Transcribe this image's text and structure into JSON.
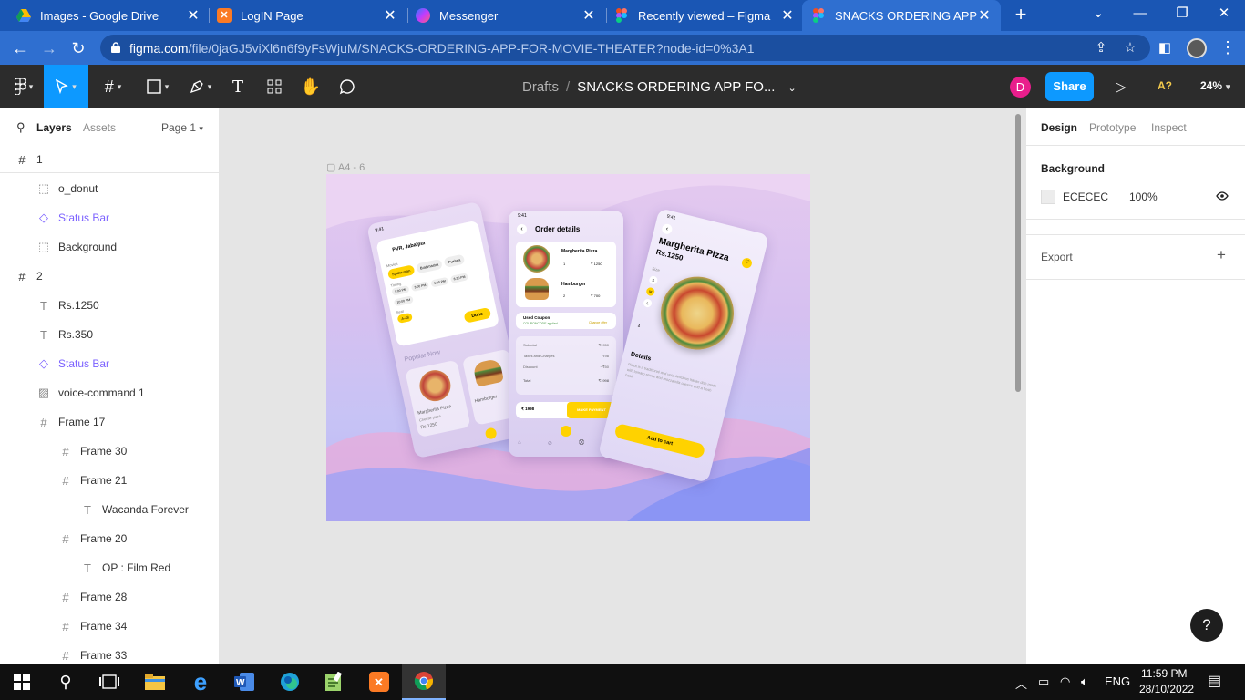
{
  "browser": {
    "tabs": [
      {
        "title": "Images - Google Drive",
        "icon": "google-drive-icon",
        "color": "#fbbc04"
      },
      {
        "title": "LogIN Page",
        "icon": "xampp-icon",
        "color": "#fb7a24"
      },
      {
        "title": "Messenger",
        "icon": "messenger-icon",
        "color": "#a033ff"
      },
      {
        "title": "Recently viewed – Figma",
        "icon": "figma-icon",
        "color": "#f24e1e"
      },
      {
        "title": "SNACKS ORDERING APP FOR",
        "icon": "figma-icon",
        "color": "#f24e1e"
      }
    ],
    "url_host": "figma.com",
    "url_path": "/file/0jaGJ5viXl6n6f9yFsWjuM/SNACKS-ORDERING-APP-FOR-MOVIE-THEATER?node-id=0%3A1"
  },
  "figma": {
    "breadcrumb_root": "Drafts",
    "file_name": "SNACKS ORDERING APP FO...",
    "avatar_initial": "D",
    "share_label": "Share",
    "a_question": "A?",
    "zoom": "24%",
    "left_tabs": {
      "layers": "Layers",
      "assets": "Assets",
      "page": "Page 1"
    },
    "layers": [
      {
        "label": "1",
        "icon": "#",
        "level": 0,
        "comp": false
      },
      {
        "label": "o_donut",
        "icon": "⬚",
        "level": 1,
        "comp": false
      },
      {
        "label": "Status Bar",
        "icon": "◇",
        "level": 1,
        "comp": true
      },
      {
        "label": "Background",
        "icon": "⬚",
        "level": 1,
        "comp": false
      },
      {
        "label": "2",
        "icon": "#",
        "level": 0,
        "comp": false
      },
      {
        "label": "Rs.1250",
        "icon": "T",
        "level": 1,
        "comp": false
      },
      {
        "label": "Rs.350",
        "icon": "T",
        "level": 1,
        "comp": false
      },
      {
        "label": "Status Bar",
        "icon": "◇",
        "level": 1,
        "comp": true
      },
      {
        "label": "voice-command 1",
        "icon": "▨",
        "level": 1,
        "comp": false
      },
      {
        "label": "Frame 17",
        "icon": "#",
        "level": 1,
        "comp": false
      },
      {
        "label": "Frame 30",
        "icon": "#",
        "level": 2,
        "comp": false
      },
      {
        "label": "Frame 21",
        "icon": "#",
        "level": 2,
        "comp": false
      },
      {
        "label": "Wacanda Forever",
        "icon": "T",
        "level": 3,
        "comp": false
      },
      {
        "label": "Frame 20",
        "icon": "#",
        "level": 2,
        "comp": false
      },
      {
        "label": "OP : Film Red",
        "icon": "T",
        "level": 3,
        "comp": false
      },
      {
        "label": "Frame 28",
        "icon": "#",
        "level": 2,
        "comp": false
      },
      {
        "label": "Frame 34",
        "icon": "#",
        "level": 2,
        "comp": false
      },
      {
        "label": "Frame 33",
        "icon": "#",
        "level": 2,
        "comp": false
      }
    ],
    "frame_label": "A4 - 6",
    "mockup": {
      "screen1": {
        "time": "9:41",
        "location": "PVR, Jabalpur",
        "sort_label": "Movies",
        "chips": [
          "Spider-man",
          "Brahmastra",
          "Pushpa",
          "Avatar"
        ],
        "times_label": "Timing",
        "times": [
          "1:00 PM",
          "3:00 PM",
          "5:00 PM",
          "6:30 PM"
        ],
        "extra_time": "10:00 PM",
        "seat_label": "Seat",
        "seat": "A-48",
        "done": "Done",
        "popular": "Popular Now",
        "card1_title": "Margherita Pizza",
        "card1_sub": "Cheese pizza",
        "card1_price": "Rs.1250",
        "card2_title": "Hamburger"
      },
      "screen2": {
        "time": "9:41",
        "title": "Order details",
        "item1_name": "Margherita Pizza",
        "item1_qty": "1",
        "item1_price": "₹ 1250",
        "item2_name": "Hamburger",
        "item2_qty": "2",
        "item2_price": "₹ 700",
        "coupon_title": "Used Coupon",
        "coupon_sub": "COUPONCODE applied",
        "coupon_link": "Change offer",
        "rows": [
          {
            "label": "Subtotal",
            "value": "₹1950"
          },
          {
            "label": "Taxes and Charges",
            "value": "₹98"
          },
          {
            "label": "Discount",
            "value": "−₹50"
          },
          {
            "label": "Total",
            "value": "₹1998"
          }
        ],
        "total": "₹ 1998",
        "pay": "MAKE PAYMENT"
      },
      "screen3": {
        "time": "9:41",
        "title": "Margherita Pizza",
        "price": "Rs.1250",
        "size_label": "Size",
        "sizes": [
          "S",
          "M",
          "L"
        ],
        "qty": "1",
        "details_label": "Details",
        "details_text": "Pizza is a traditional and very delicious Italian dish made with tomato sauce and mozzarella cheese and a fresh basil.",
        "cart": "Add to cart"
      }
    },
    "right_tabs": {
      "design": "Design",
      "prototype": "Prototype",
      "inspect": "Inspect"
    },
    "background_label": "Background",
    "background_hex": "ECECEC",
    "background_opacity": "100%",
    "export_label": "Export",
    "help": "?"
  },
  "taskbar": {
    "lang": "ENG",
    "time": "11:59 PM",
    "date": "28/10/2022"
  }
}
